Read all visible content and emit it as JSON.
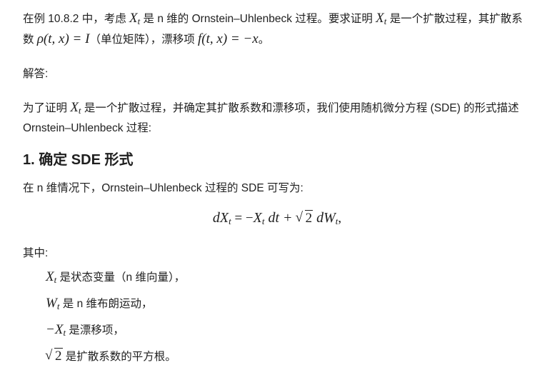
{
  "intro": {
    "t1": "在例 10.8.2 中，考虑 ",
    "m1": "X",
    "m1sub": "t",
    "t2": " 是 n 维的 Ornstein–Uhlenbeck 过程。要求证明 ",
    "m2": "X",
    "m2sub": "t",
    "t3": " 是一个扩散过程，其扩散系数 ",
    "m3": "ρ(t, x) = I",
    "t4": "（单位矩阵），漂移项 ",
    "m4": "f(t, x) = −x",
    "t5": "。"
  },
  "answer_label": "解答:",
  "para3": {
    "t1": "为了证明 ",
    "m1": "X",
    "m1sub": "t",
    "t2": " 是一个扩散过程，并确定其扩散系数和漂移项，我们使用随机微分方程 (SDE) 的形式描述 Ornstein–Uhlenbeck 过程:"
  },
  "section1_title": "1. 确定 SDE 形式",
  "para4": "在 n 维情况下，Ornstein–Uhlenbeck 过程的 SDE 可写为:",
  "equation": {
    "lhs": "dX",
    "lhs_sub": "t",
    "eq": " = −",
    "x": "X",
    "x_sub": "t",
    "dt": " dt + ",
    "sqrt": "2",
    "dw": " dW",
    "dw_sub": "t",
    "end": ","
  },
  "where_label": "其中:",
  "items": [
    {
      "math": "X",
      "sub": "t",
      "pre": "",
      "text": " 是状态变量（n 维向量），"
    },
    {
      "math": "W",
      "sub": "t",
      "pre": "",
      "text": " 是 n 维布朗运动，"
    },
    {
      "math": "X",
      "sub": "t",
      "pre": "−",
      "text": " 是漂移项，"
    },
    {
      "math": "",
      "sub": "",
      "pre": "",
      "sqrt": "2",
      "text": " 是扩散系数的平方根。"
    }
  ]
}
